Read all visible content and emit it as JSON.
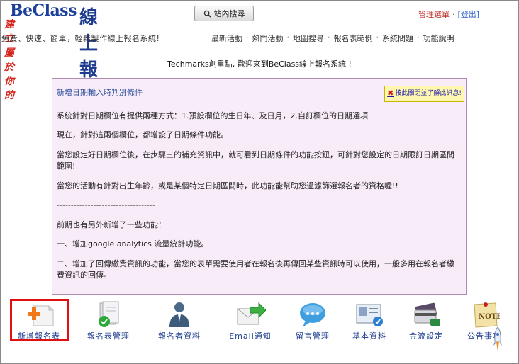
{
  "header": {
    "logo_en": "BeClass",
    "logo_zh": "線上報名表",
    "logo_sub": "建立屬於你的",
    "slogan": "免費、快速、簡單，輕鬆製作線上報名系統!",
    "search_label": "站內搜尋",
    "admin_menu": "管理選單",
    "logout": "[登出]",
    "nav": [
      "最新活動",
      "熱門活動",
      "地圖搜尋",
      "報名表範例",
      "系統問題",
      "功能說明"
    ]
  },
  "welcome": "Techmarks創重點, 歡迎來到BeClass線上報名系統 !",
  "content": {
    "title": "新增日期輸入時判別條件",
    "close_label": "按此關閉並了解此訊息!",
    "paragraphs": [
      "系統針對日期欄位有提供兩種方式：1.預設欄位的生日年、及日月，2.自訂欄位的日期選項",
      "現在，針對這兩個欄位，都增設了日期條件功能。",
      "當您設定好日期欄位後，在步驟三的補充資訊中，就可看到日期條件的功能按鈕，可針對您設定的日期限訂日期區間範圍!",
      "當您的活動有針對出生年齡，或是某個特定日期區間時，此功能能幫助您過濾篩選報名者的資格喔!!",
      "-----------------------------------",
      "前期也有另外新增了一些功能：",
      "一、增加google analytics 流量統計功能。",
      "二、增加了回傳繳費資訊的功能，當您的表單需要使用者在報名後再傳回某些資訊時可以使用，一般多用在報名者繳費資訊的回傳。"
    ]
  },
  "toolbar": {
    "items": [
      {
        "label": "新增報名表",
        "icon": "new-form-icon"
      },
      {
        "label": "報名表管理",
        "icon": "form-manage-icon"
      },
      {
        "label": "報名者資料",
        "icon": "registrant-icon"
      },
      {
        "label": "Email通知",
        "icon": "email-icon"
      },
      {
        "label": "留言管理",
        "icon": "message-icon"
      },
      {
        "label": "基本資料",
        "icon": "profile-icon"
      },
      {
        "label": "金流設定",
        "icon": "payment-icon"
      },
      {
        "label": "公告事項",
        "icon": "notice-icon"
      }
    ]
  },
  "colors": {
    "accent_blue": "#1d3c8f",
    "alert_red": "#e01010",
    "content_bg": "#f8ecf8"
  }
}
